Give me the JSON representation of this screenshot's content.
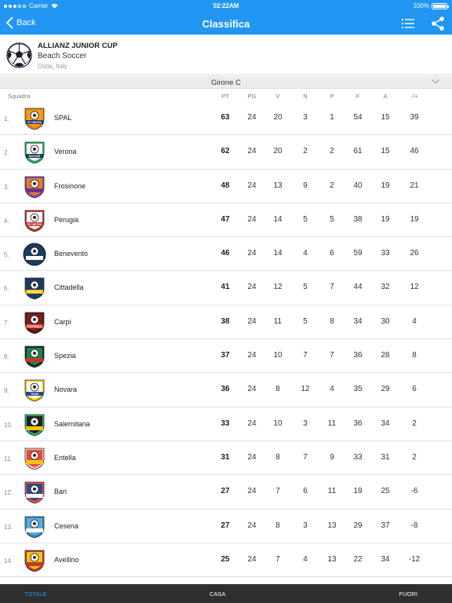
{
  "statusbar": {
    "carrier": "Carrier",
    "time": "02:22AM",
    "battery": "100%"
  },
  "navbar": {
    "back_label": "Back",
    "title": "Classifica"
  },
  "competition": {
    "name": "ALLIANZ JUNIOR CUP",
    "sport": "Beach Soccer",
    "place": "Ostia, Italy"
  },
  "group": {
    "title": "Girone C"
  },
  "table": {
    "headers": {
      "team": "Squadra",
      "pt": "PT",
      "pg": "PG",
      "v": "V",
      "n": "N",
      "p": "P",
      "f": "F",
      "a": "A",
      "diff": "-/+"
    },
    "rows": [
      {
        "rank": "1.",
        "team": "SPAL",
        "pt": "63",
        "pg": "24",
        "v": "20",
        "n": "3",
        "p": "1",
        "f": "54",
        "a": "15",
        "diff": "39",
        "badge": "fc-united-orange"
      },
      {
        "rank": "2.",
        "team": "Verona",
        "pt": "62",
        "pg": "24",
        "v": "20",
        "n": "2",
        "p": "2",
        "f": "61",
        "a": "15",
        "diff": "46",
        "badge": "soccer-green"
      },
      {
        "rank": "3.",
        "team": "Frosinone",
        "pt": "48",
        "pg": "24",
        "v": "13",
        "n": "9",
        "p": "2",
        "f": "40",
        "a": "19",
        "diff": "21",
        "badge": "shield-orange-purple"
      },
      {
        "rank": "4.",
        "team": "Perugia",
        "pt": "47",
        "pg": "24",
        "v": "14",
        "n": "5",
        "p": "5",
        "f": "38",
        "a": "19",
        "diff": "19",
        "badge": "fc-united-red"
      },
      {
        "rank": "5.",
        "team": "Benevento",
        "pt": "46",
        "pg": "24",
        "v": "14",
        "n": "4",
        "p": "6",
        "f": "59",
        "a": "33",
        "diff": "26",
        "badge": "soccer-club-navy"
      },
      {
        "rank": "6.",
        "team": "Cittadella",
        "pt": "41",
        "pg": "24",
        "v": "12",
        "n": "5",
        "p": "7",
        "f": "44",
        "a": "32",
        "diff": "12",
        "badge": "football-navy"
      },
      {
        "rank": "7.",
        "team": "Carpi",
        "pt": "38",
        "pg": "24",
        "v": "11",
        "n": "5",
        "p": "8",
        "f": "34",
        "a": "30",
        "diff": "4",
        "badge": "football-maroon"
      },
      {
        "rank": "8.",
        "team": "Spezia",
        "pt": "37",
        "pg": "24",
        "v": "10",
        "n": "7",
        "p": "7",
        "f": "36",
        "a": "28",
        "diff": "8",
        "badge": "football-club-green"
      },
      {
        "rank": "9.",
        "team": "Novara",
        "pt": "36",
        "pg": "24",
        "v": "8",
        "n": "12",
        "p": "4",
        "f": "35",
        "a": "29",
        "diff": "6",
        "badge": "team-blue-yellow"
      },
      {
        "rank": "10.",
        "team": "Salernitana",
        "pt": "33",
        "pg": "24",
        "v": "10",
        "n": "3",
        "p": "11",
        "f": "36",
        "a": "34",
        "diff": "2",
        "badge": "soccer-club-green"
      },
      {
        "rank": "11.",
        "team": "Entella",
        "pt": "31",
        "pg": "24",
        "v": "8",
        "n": "7",
        "p": "9",
        "f": "33",
        "a": "31",
        "diff": "2",
        "badge": "crown-red"
      },
      {
        "rank": "12.",
        "team": "Bari",
        "pt": "27",
        "pg": "24",
        "v": "7",
        "n": "6",
        "p": "11",
        "f": "19",
        "a": "25",
        "diff": "-6",
        "badge": "shield-blue-red"
      },
      {
        "rank": "13.",
        "team": "Cesena",
        "pt": "27",
        "pg": "24",
        "v": "8",
        "n": "3",
        "p": "13",
        "f": "29",
        "a": "37",
        "diff": "-8",
        "badge": "shield-sky"
      },
      {
        "rank": "14.",
        "team": "Avellino",
        "pt": "25",
        "pg": "24",
        "v": "7",
        "n": "4",
        "p": "13",
        "f": "22",
        "a": "34",
        "diff": "-12",
        "badge": "crest-yellow-red"
      }
    ]
  },
  "tabbar": {
    "tabs": [
      {
        "label": "TOTALE",
        "active": true
      },
      {
        "label": "CASA",
        "active": false
      },
      {
        "label": "FUORI",
        "active": false
      }
    ]
  },
  "colors": {
    "accent": "#2196f3",
    "tabbar": "#2f2f2f",
    "group_bar": "#ececec"
  }
}
